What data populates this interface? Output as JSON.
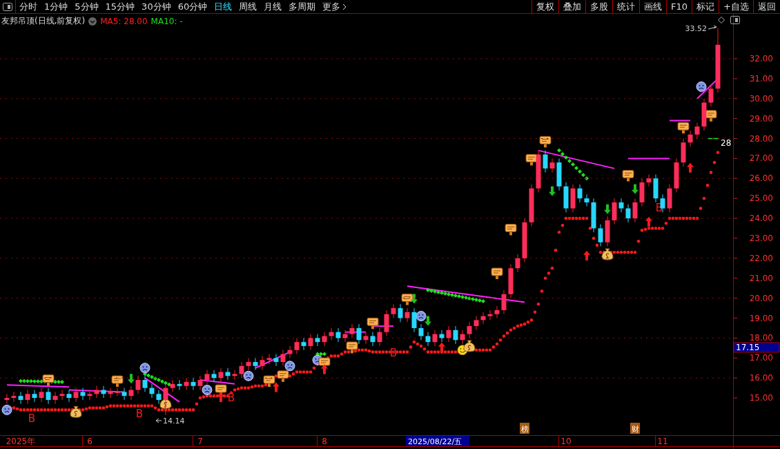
{
  "toolbar": {
    "periods": [
      {
        "label": "分时",
        "selected": false
      },
      {
        "label": "1分钟",
        "selected": false
      },
      {
        "label": "5分钟",
        "selected": false
      },
      {
        "label": "15分钟",
        "selected": false
      },
      {
        "label": "30分钟",
        "selected": false
      },
      {
        "label": "60分钟",
        "selected": false
      },
      {
        "label": "日线",
        "selected": true
      },
      {
        "label": "周线",
        "selected": false
      },
      {
        "label": "月线",
        "selected": false
      },
      {
        "label": "多周期",
        "selected": false
      },
      {
        "label": "更多",
        "selected": false
      }
    ],
    "actions": [
      "复权",
      "叠加",
      "多股",
      "统计",
      "画线",
      "F10",
      "标记",
      "+自选",
      "返回"
    ]
  },
  "chart_header": {
    "title": "友邦吊顶(日线,前复权)",
    "indicators": [
      {
        "label": "MA5: 28.00",
        "color": "#ff2020"
      },
      {
        "label": "MA10: -",
        "color": "#20e020"
      }
    ]
  },
  "chart_data": {
    "type": "candlestick",
    "grid": true,
    "ylim": [
      12.44,
      34.25
    ],
    "yticks": [
      {
        "value": 15,
        "label": "15.00"
      },
      {
        "value": 16,
        "label": "16.00"
      },
      {
        "value": 17,
        "label": "17.00"
      },
      {
        "value": 18,
        "label": "18.00"
      },
      {
        "value": 19,
        "label": "19.00"
      },
      {
        "value": 20,
        "label": "20.00"
      },
      {
        "value": 21,
        "label": "21.00"
      },
      {
        "value": 22,
        "label": "22.00"
      },
      {
        "value": 23,
        "label": "23.00"
      },
      {
        "value": 24,
        "label": "24.00"
      },
      {
        "value": 25,
        "label": "25.00"
      },
      {
        "value": 26,
        "label": "26.00"
      },
      {
        "value": 27,
        "label": "27.00"
      },
      {
        "value": 28,
        "label": "28.00"
      },
      {
        "value": 29,
        "label": "29.00"
      },
      {
        "value": 30,
        "label": "30.00"
      },
      {
        "value": 31,
        "label": "31.00"
      },
      {
        "value": 32,
        "label": "32.00"
      }
    ],
    "categories": [
      null,
      null,
      "2025年",
      null,
      null,
      null,
      null,
      null,
      null,
      null,
      null,
      null,
      "6",
      null,
      null,
      null,
      null,
      null,
      null,
      null,
      null,
      null,
      null,
      null,
      null,
      null,
      null,
      null,
      "7",
      null,
      null,
      null,
      null,
      null,
      null,
      null,
      null,
      null,
      null,
      null,
      null,
      null,
      null,
      null,
      null,
      null,
      "8",
      null,
      null,
      null,
      null,
      null,
      null,
      null,
      null,
      null,
      null,
      null,
      null,
      null,
      null,
      null,
      null,
      null,
      null,
      null,
      null,
      null,
      null,
      null,
      null,
      null,
      null,
      null,
      null,
      null,
      null,
      null,
      null,
      null,
      null,
      "10",
      null,
      null,
      null,
      null,
      null,
      null,
      null,
      null,
      null,
      null,
      null,
      null,
      null,
      "11",
      null,
      null,
      null,
      null,
      null,
      null,
      null,
      null
    ],
    "ohlc": [
      [
        14.9,
        15.2,
        14.7,
        15.0
      ],
      [
        15.0,
        15.3,
        14.8,
        15.1
      ],
      [
        15.1,
        15.3,
        14.7,
        14.9
      ],
      [
        14.9,
        15.4,
        14.7,
        15.2
      ],
      [
        15.2,
        15.4,
        14.8,
        15.0
      ],
      [
        15.0,
        15.5,
        14.8,
        15.3
      ],
      [
        15.3,
        15.5,
        14.7,
        14.9
      ],
      [
        14.9,
        15.3,
        14.7,
        15.1
      ],
      [
        15.1,
        15.4,
        14.9,
        15.2
      ],
      [
        15.2,
        15.4,
        14.8,
        15.0
      ],
      [
        15.0,
        15.5,
        14.8,
        15.3
      ],
      [
        15.3,
        15.5,
        14.9,
        15.1
      ],
      [
        15.1,
        15.4,
        14.9,
        15.2
      ],
      [
        15.2,
        15.6,
        15.0,
        15.4
      ],
      [
        15.4,
        15.6,
        15.0,
        15.2
      ],
      [
        15.2,
        15.5,
        15.0,
        15.3
      ],
      [
        15.3,
        15.5,
        15.1,
        15.3
      ],
      [
        15.3,
        15.5,
        14.9,
        15.1
      ],
      [
        15.1,
        15.6,
        14.9,
        15.4
      ],
      [
        15.4,
        16.1,
        15.2,
        15.9
      ],
      [
        15.9,
        16.1,
        15.3,
        15.5
      ],
      [
        15.5,
        15.7,
        15.0,
        15.2
      ],
      [
        15.2,
        15.4,
        14.7,
        14.9
      ],
      [
        14.9,
        15.7,
        14.14,
        15.5
      ],
      [
        15.5,
        15.9,
        15.3,
        15.7
      ],
      [
        15.7,
        15.9,
        15.4,
        15.6
      ],
      [
        15.6,
        16.0,
        15.4,
        15.8
      ],
      [
        15.8,
        16.0,
        15.4,
        15.6
      ],
      [
        15.6,
        16.1,
        15.4,
        15.9
      ],
      [
        15.9,
        16.4,
        15.7,
        16.2
      ],
      [
        16.2,
        16.4,
        15.8,
        16.0
      ],
      [
        16.0,
        16.5,
        15.8,
        16.3
      ],
      [
        16.3,
        16.5,
        15.9,
        16.1
      ],
      [
        16.1,
        16.4,
        15.9,
        16.2
      ],
      [
        16.2,
        16.8,
        16.0,
        16.6
      ],
      [
        16.6,
        17.0,
        16.4,
        16.8
      ],
      [
        16.8,
        17.0,
        16.4,
        16.6
      ],
      [
        16.6,
        17.1,
        16.4,
        16.9
      ],
      [
        16.9,
        17.2,
        16.7,
        17.0
      ],
      [
        17.0,
        17.2,
        16.6,
        16.8
      ],
      [
        16.8,
        17.4,
        16.6,
        17.2
      ],
      [
        17.2,
        17.6,
        17.0,
        17.4
      ],
      [
        17.4,
        18.0,
        17.2,
        17.8
      ],
      [
        17.8,
        18.0,
        17.4,
        17.6
      ],
      [
        17.6,
        18.2,
        17.4,
        18.0
      ],
      [
        18.0,
        18.2,
        17.6,
        17.8
      ],
      [
        17.8,
        18.3,
        17.6,
        18.1
      ],
      [
        18.1,
        18.5,
        17.9,
        18.3
      ],
      [
        18.3,
        18.5,
        17.8,
        18.0
      ],
      [
        18.0,
        18.4,
        17.8,
        18.2
      ],
      [
        18.2,
        18.7,
        18.0,
        18.5
      ],
      [
        18.5,
        18.7,
        17.7,
        17.9
      ],
      [
        17.9,
        18.3,
        17.7,
        18.1
      ],
      [
        18.1,
        18.3,
        17.6,
        17.8
      ],
      [
        17.8,
        18.5,
        17.6,
        18.3
      ],
      [
        18.3,
        19.4,
        18.1,
        19.2
      ],
      [
        19.2,
        19.7,
        19.0,
        19.5
      ],
      [
        19.5,
        19.7,
        18.8,
        19.0
      ],
      [
        19.0,
        19.5,
        18.8,
        19.3
      ],
      [
        19.3,
        19.5,
        18.3,
        18.5
      ],
      [
        18.5,
        18.7,
        17.9,
        18.1
      ],
      [
        18.1,
        18.3,
        17.6,
        17.8
      ],
      [
        17.8,
        18.4,
        17.6,
        18.2
      ],
      [
        18.2,
        18.4,
        17.8,
        18.0
      ],
      [
        18.0,
        18.6,
        17.8,
        18.4
      ],
      [
        18.4,
        18.6,
        17.7,
        17.9
      ],
      [
        17.9,
        18.4,
        17.7,
        18.2
      ],
      [
        18.2,
        18.8,
        18.0,
        18.6
      ],
      [
        18.6,
        19.1,
        18.4,
        18.9
      ],
      [
        18.9,
        19.3,
        18.7,
        19.1
      ],
      [
        19.1,
        19.4,
        18.9,
        19.2
      ],
      [
        19.2,
        19.6,
        19.0,
        19.4
      ],
      [
        19.4,
        20.4,
        19.2,
        20.2
      ],
      [
        20.2,
        21.7,
        20.0,
        21.5
      ],
      [
        21.5,
        22.2,
        21.3,
        22.0
      ],
      [
        22.0,
        24.0,
        21.8,
        23.8
      ],
      [
        23.8,
        25.7,
        23.6,
        25.5
      ],
      [
        25.5,
        27.4,
        25.3,
        27.2
      ],
      [
        27.2,
        27.4,
        26.3,
        26.5
      ],
      [
        26.5,
        27.0,
        26.3,
        26.8
      ],
      [
        26.8,
        27.0,
        25.4,
        25.6
      ],
      [
        25.6,
        25.8,
        24.3,
        24.5
      ],
      [
        24.5,
        25.7,
        24.3,
        25.5
      ],
      [
        25.5,
        25.7,
        24.8,
        25.0
      ],
      [
        25.0,
        25.2,
        24.6,
        24.8
      ],
      [
        24.8,
        25.0,
        23.3,
        23.5
      ],
      [
        23.5,
        23.7,
        22.6,
        22.8
      ],
      [
        22.8,
        24.1,
        22.6,
        23.9
      ],
      [
        23.9,
        25.0,
        23.7,
        24.8
      ],
      [
        24.8,
        25.0,
        24.3,
        24.5
      ],
      [
        24.5,
        24.7,
        23.8,
        24.0
      ],
      [
        24.0,
        25.0,
        23.8,
        24.8
      ],
      [
        24.8,
        26.0,
        24.6,
        25.8
      ],
      [
        25.8,
        26.2,
        25.6,
        26.0
      ],
      [
        26.0,
        26.2,
        24.8,
        25.0
      ],
      [
        25.0,
        25.2,
        24.3,
        24.5
      ],
      [
        24.5,
        25.7,
        24.3,
        25.5
      ],
      [
        25.5,
        27.0,
        25.3,
        26.8
      ],
      [
        26.8,
        28.0,
        26.6,
        27.8
      ],
      [
        27.8,
        28.4,
        27.6,
        28.2
      ],
      [
        28.2,
        28.8,
        28.0,
        28.6
      ],
      [
        28.6,
        30.0,
        28.4,
        29.8
      ],
      [
        29.8,
        30.7,
        29.6,
        30.5
      ],
      [
        30.5,
        33.52,
        30.3,
        32.7
      ]
    ]
  },
  "overlay": {
    "signals": [
      {
        "label": "B"
      },
      {
        "label": "B"
      },
      {
        "label": "B"
      },
      {
        "label": "B"
      },
      {
        "label": "B"
      }
    ],
    "high_note": "33.52",
    "low_note": "14.14",
    "level_note": "28",
    "badges": [
      "榜",
      "财"
    ],
    "cursor_date": "2025/08/22/五",
    "price_tag": "17.15"
  }
}
